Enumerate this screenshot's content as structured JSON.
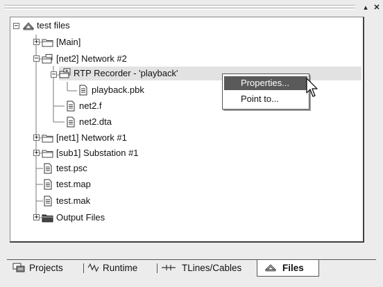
{
  "pane_controls": {
    "pin": "▴",
    "close": "✕"
  },
  "tree": {
    "root": {
      "label": "test files",
      "icon": "workspace-icon"
    },
    "items": [
      {
        "label": "[Main]",
        "icon": "folder-icon"
      },
      {
        "label": "[net2] Network #2",
        "icon": "network-icon"
      },
      {
        "label": "RTP Recorder - 'playback'",
        "icon": "recorder-icon"
      },
      {
        "label": "playback.pbk",
        "icon": "file-icon"
      },
      {
        "label": "net2.f",
        "icon": "file-icon"
      },
      {
        "label": "net2.dta",
        "icon": "file-icon"
      },
      {
        "label": "[net1] Network #1",
        "icon": "folder-icon"
      },
      {
        "label": "[sub1] Substation #1",
        "icon": "folder-icon"
      },
      {
        "label": "test.psc",
        "icon": "file-icon"
      },
      {
        "label": "test.map",
        "icon": "file-icon"
      },
      {
        "label": "test.mak",
        "icon": "file-icon"
      },
      {
        "label": "Output Files",
        "icon": "folder-dark-icon"
      }
    ]
  },
  "context_menu": {
    "items": [
      {
        "label": "Properties..."
      },
      {
        "label": "Point to..."
      }
    ]
  },
  "tabs": [
    {
      "label": "Projects",
      "icon": "projects-icon"
    },
    {
      "label": "Runtime",
      "icon": "runtime-icon"
    },
    {
      "label": "TLines/Cables",
      "icon": "tlines-icon"
    },
    {
      "label": "Files",
      "icon": "files-icon",
      "active": true
    }
  ]
}
